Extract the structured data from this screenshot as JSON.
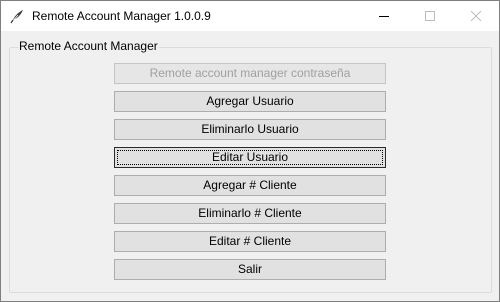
{
  "window": {
    "title": "Remote Account Manager 1.0.0.9",
    "app_icon": "feather-quill-icon",
    "controls": [
      "minimize-icon",
      "maximize-icon",
      "close-icon"
    ]
  },
  "group": {
    "label": "Remote Account Manager"
  },
  "buttons": [
    {
      "label": "Remote account manager contraseña",
      "state": "disabled"
    },
    {
      "label": "Agregar Usuario",
      "state": "normal"
    },
    {
      "label": "Eliminarlo Usuario",
      "state": "normal"
    },
    {
      "label": "Editar Usuario",
      "state": "focused"
    },
    {
      "label": "Agregar # Cliente",
      "state": "normal"
    },
    {
      "label": "Eliminarlo # Cliente",
      "state": "normal"
    },
    {
      "label": "Editar # Cliente",
      "state": "normal"
    },
    {
      "label": "Salir",
      "state": "normal"
    }
  ],
  "colors": {
    "window_bg": "#f0f0f0",
    "titlebar_bg": "#ffffff",
    "button_bg": "#e1e1e1",
    "disabled_text": "#a0a0a0"
  }
}
